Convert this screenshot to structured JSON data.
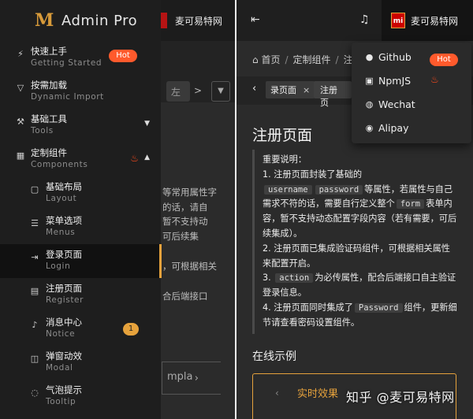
{
  "left_panel": {
    "background_content": {
      "brand": "麦可易特网",
      "tab_text": "左",
      "arrow": ">",
      "lines": [
        "等常用属性字",
        "的话，请自",
        "暂不支持动",
        "可后续集",
        "，可根据相关",
        "合后端接口"
      ],
      "demo_box": "mpla"
    },
    "logo": {
      "mark": "M",
      "title": "Admin Pro"
    },
    "menu": [
      {
        "label": "快速上手",
        "sub": "Getting Started",
        "icon": "bolt-icon",
        "badge": "Hot"
      },
      {
        "label": "按需加载",
        "sub": "Dynamic Import",
        "icon": "filter-icon"
      },
      {
        "label": "基础工具",
        "sub": "Tools",
        "icon": "wrench-icon",
        "chevron": "down"
      },
      {
        "label": "定制组件",
        "sub": "Components",
        "icon": "grid-icon",
        "chevron": "up",
        "flame": true
      },
      {
        "label": "基础布局",
        "sub": "Layout",
        "icon": "layout-icon",
        "level": 2
      },
      {
        "label": "菜单选项",
        "sub": "Menus",
        "icon": "list-icon",
        "level": 2
      },
      {
        "label": "登录页面",
        "sub": "Login",
        "icon": "login-icon",
        "level": 2,
        "active": true
      },
      {
        "label": "注册页面",
        "sub": "Register",
        "icon": "register-icon",
        "level": 2
      },
      {
        "label": "消息中心",
        "sub": "Notice",
        "icon": "bell-icon",
        "level": 2,
        "count": "1"
      },
      {
        "label": "弹窗动效",
        "sub": "Modal",
        "icon": "modal-icon",
        "level": 2
      },
      {
        "label": "气泡提示",
        "sub": "Tooltip",
        "icon": "bubble-icon",
        "level": 2
      }
    ]
  },
  "right_panel": {
    "header": {
      "user_logo": "mi",
      "user_name": "麦可易特网"
    },
    "breadcrumb": [
      "首页",
      "定制组件",
      "注"
    ],
    "tabs": [
      {
        "label": "录页面",
        "closable": true
      },
      {
        "label": "注册页"
      }
    ],
    "page_title": "注册页面",
    "notice": {
      "heading": "重要说明：",
      "p1_a": "1. 注册页面封装了基础的",
      "code_username": "username",
      "code_password": "password",
      "p1_b": "等属性，若属性与自己需求不符的话，需要自行定义整个",
      "code_form": "form",
      "p1_c": "表单内容，暂不支持动态配置字段内容（若有需要，可后续集成）。",
      "p2": "2. 注册页面已集成验证码组件，可根据相关属性来配置开启。",
      "p3_a": "3.",
      "code_action": "action",
      "p3_b": "为必传属性，配合后端接口自主验证登录信息。",
      "p4_a": "4. 注册页面同时集成了",
      "code_password_cap": "Password",
      "p4_b": "组件，更新细节请查看密码设置组件。"
    },
    "section_title": "在线示例",
    "demo_tab": "实时效果",
    "dropdown": [
      {
        "label": "Github",
        "icon": "github-icon",
        "badge": "Hot"
      },
      {
        "label": "NpmJS",
        "icon": "npm-icon",
        "flame": true
      },
      {
        "label": "Wechat",
        "icon": "wechat-icon"
      },
      {
        "label": "Alipay",
        "icon": "alipay-icon"
      }
    ],
    "watermark": "知乎 @麦可易特网"
  },
  "colors": {
    "accent": "#e6a23c",
    "hot": "#ff5a2c",
    "flame": "#ff4a1c",
    "sidebar_bg": "#1e1e1e",
    "panel_bg": "#2b2b2b"
  }
}
